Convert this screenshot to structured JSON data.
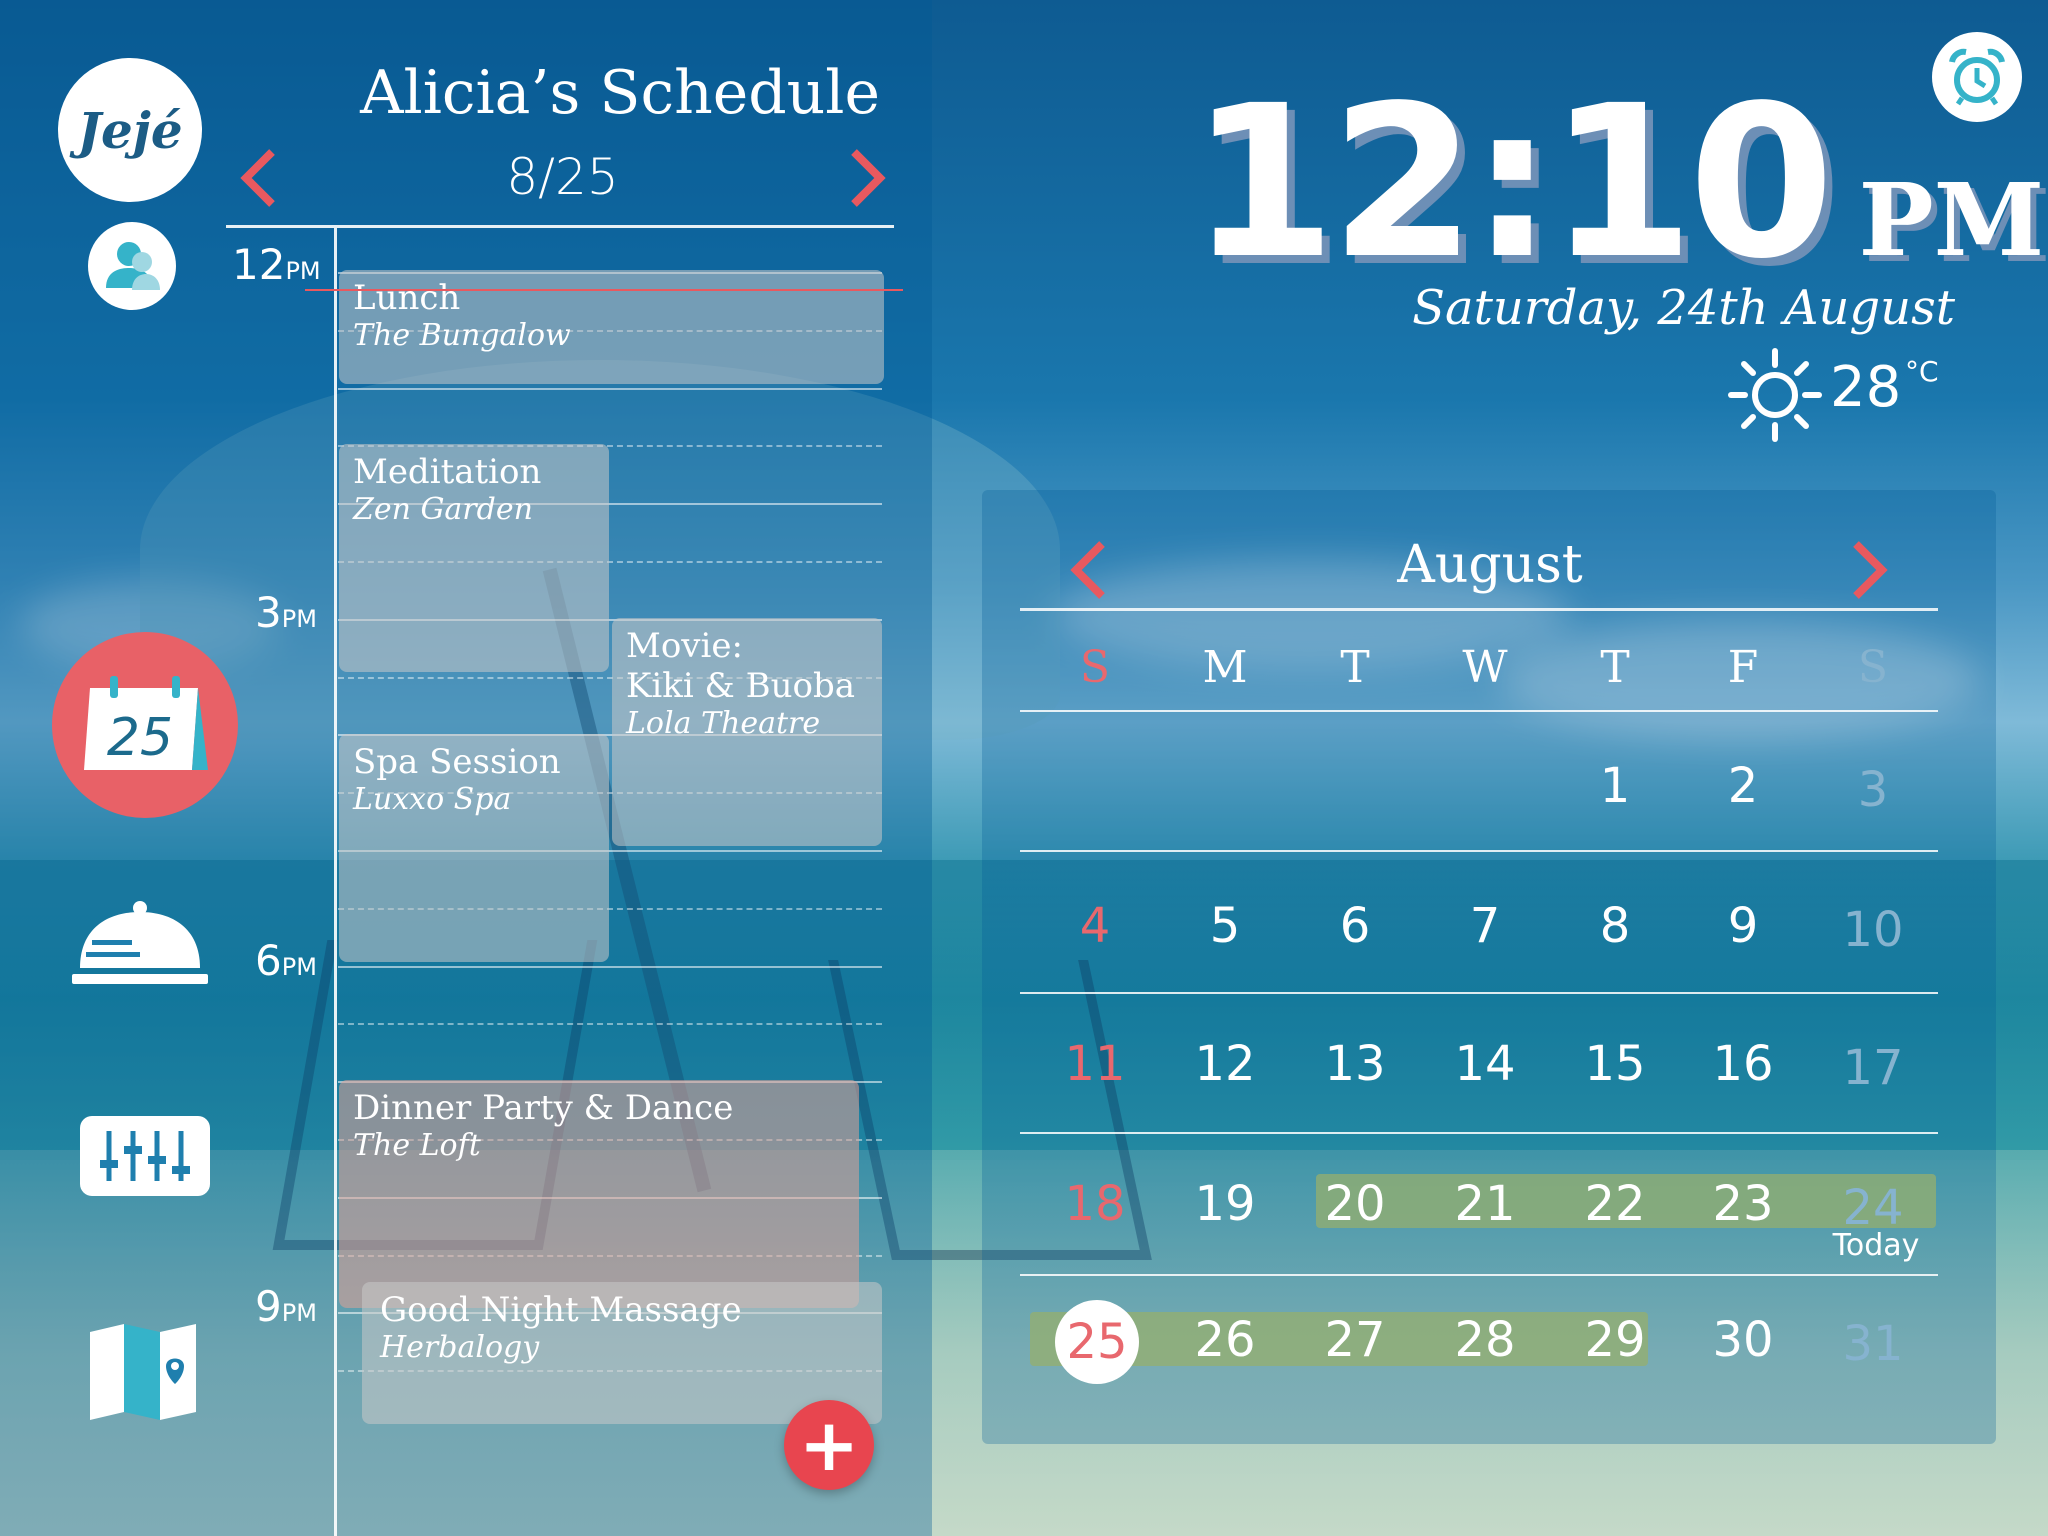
{
  "nav": {
    "logo_text": "Jejé",
    "calendar_icon_day": "25",
    "items": [
      {
        "name": "profile",
        "icon": "user-icon"
      },
      {
        "name": "calendar",
        "icon": "calendar-icon",
        "active": true
      },
      {
        "name": "dining",
        "icon": "cloche-icon"
      },
      {
        "name": "settings",
        "icon": "sliders-icon"
      },
      {
        "name": "map",
        "icon": "map-icon"
      }
    ]
  },
  "schedule": {
    "title": "Alicia’s Schedule",
    "date": "8/25",
    "hours": [
      {
        "num": "12",
        "suffix": "PM"
      },
      {
        "num": "3",
        "suffix": "PM"
      },
      {
        "num": "6",
        "suffix": "PM"
      },
      {
        "num": "9",
        "suffix": "PM"
      }
    ],
    "events": [
      {
        "title": "Lunch",
        "place": "The Bungalow"
      },
      {
        "title": "Meditation",
        "place": "Zen Garden"
      },
      {
        "title": "Movie:\nKiki & Buoba",
        "place": "Lola Theatre"
      },
      {
        "title": "Spa Session",
        "place": "Luxxo Spa"
      },
      {
        "title": "Dinner Party & Dance",
        "place": "The Loft"
      },
      {
        "title": "Good Night Massage",
        "place": "Herbalogy"
      }
    ],
    "add_label": "+"
  },
  "clock": {
    "time": "12:10",
    "ampm": "PM",
    "date": "Saturday, 24th August"
  },
  "weather": {
    "icon": "sun-icon",
    "temp": "28",
    "unit": "°C"
  },
  "calendar": {
    "month": "August",
    "weekdays": [
      "S",
      "M",
      "T",
      "W",
      "T",
      "F",
      "S"
    ],
    "weeks": [
      [
        "",
        "",
        "",
        "",
        "1",
        "2",
        "3"
      ],
      [
        "4",
        "5",
        "6",
        "7",
        "8",
        "9",
        "10"
      ],
      [
        "11",
        "12",
        "13",
        "14",
        "15",
        "16",
        "17"
      ],
      [
        "18",
        "19",
        "20",
        "21",
        "22",
        "23",
        "24"
      ],
      [
        "25",
        "26",
        "27",
        "28",
        "29",
        "30",
        "31"
      ]
    ],
    "today": "24",
    "today_label": "Today",
    "selected": "25",
    "highlight_ranges": [
      [
        "20",
        "24"
      ],
      [
        "25",
        "29"
      ]
    ]
  },
  "colors": {
    "accent_red": "#e86167",
    "range_green": "#96af6e",
    "weekend_blue": "#86b3cf"
  }
}
